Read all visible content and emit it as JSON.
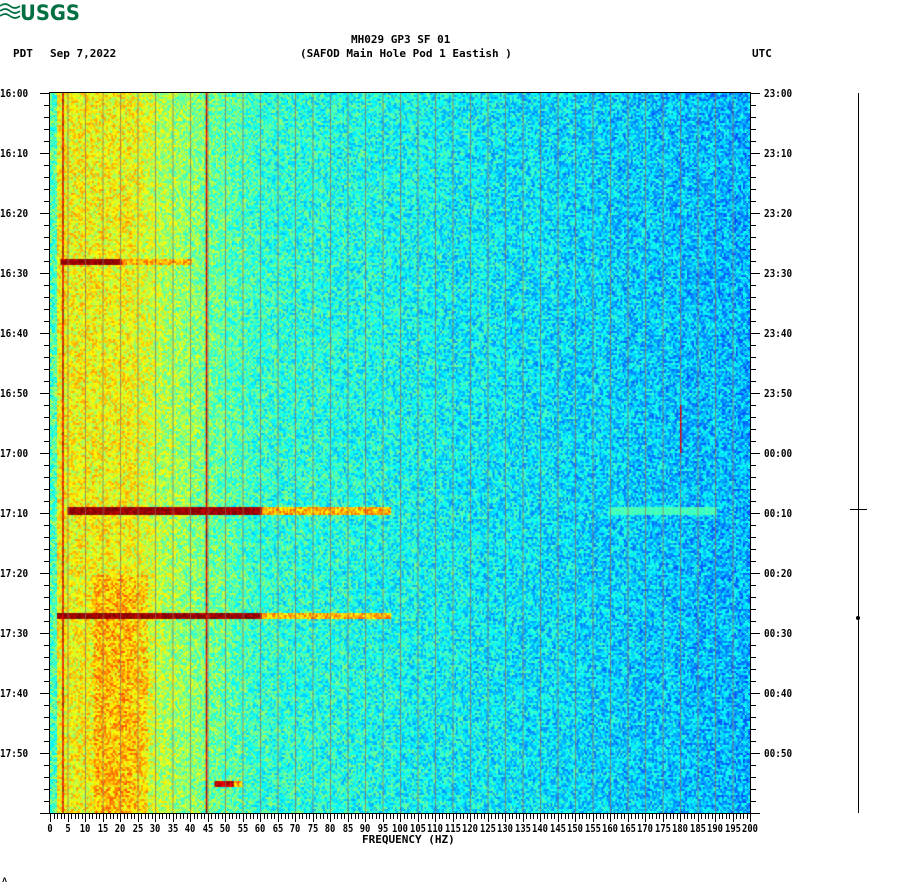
{
  "logo": {
    "text": "USGS",
    "color": "#006F41"
  },
  "header": {
    "station": "MH029 GP3 SF 01",
    "description": "(SAFOD Main Hole Pod 1 Eastish )",
    "left_tz": "PDT",
    "date": "Sep 7,2022",
    "right_tz": "UTC"
  },
  "footer_mark": "ᴧ",
  "chart_data": {
    "type": "heatmap",
    "title": "MH029 GP3 SF 01 (SAFOD Main Hole Pod 1 Eastish )",
    "xlabel": "FREQUENCY (HZ)",
    "xlim": [
      0,
      200
    ],
    "x_ticks": [
      "0",
      "5",
      "10",
      "15",
      "20",
      "25",
      "30",
      "35",
      "40",
      "45",
      "50",
      "55",
      "60",
      "65",
      "70",
      "75",
      "80",
      "85",
      "90",
      "95",
      "100",
      "105",
      "110",
      "115",
      "120",
      "125",
      "130",
      "135",
      "140",
      "145",
      "150",
      "155",
      "160",
      "165",
      "170",
      "175",
      "180",
      "185",
      "190",
      "195",
      "200"
    ],
    "ylim_minutes": [
      0,
      120
    ],
    "y_ticks_left": [
      "16:00",
      "16:10",
      "16:20",
      "16:30",
      "16:40",
      "16:50",
      "17:00",
      "17:10",
      "17:20",
      "17:30",
      "17:40",
      "17:50"
    ],
    "y_ticks_right": [
      "23:00",
      "23:10",
      "23:20",
      "23:30",
      "23:40",
      "23:50",
      "00:00",
      "00:10",
      "00:20",
      "00:30",
      "00:40",
      "00:50"
    ],
    "colormap": "jet",
    "background_level": {
      "low_freq_0_30hz": 0.62,
      "mid_60hz": 0.42,
      "high_200hz": 0.3
    },
    "events": [
      {
        "minute": 28,
        "fmin": 3,
        "fmax": 20,
        "level": 1.0,
        "tail_fmax": 40
      },
      {
        "minute": 69.5,
        "fmin": 5,
        "fmax": 60,
        "level": 1.0,
        "tail_fmax": 97
      },
      {
        "minute": 69.5,
        "fmin": 160,
        "fmax": 190,
        "level": 0.45,
        "tail_fmax": 190
      },
      {
        "minute": 87,
        "fmin": 2,
        "fmax": 60,
        "level": 1.0,
        "tail_fmax": 97
      },
      {
        "minute": 115,
        "fmin": 47,
        "fmax": 52,
        "level": 0.95,
        "tail_fmax": 55
      }
    ],
    "persistent_lines_hz": [
      3.5,
      44.5
    ],
    "intermittent_line": {
      "hz": 180,
      "minute_range": [
        52,
        60
      ]
    }
  }
}
